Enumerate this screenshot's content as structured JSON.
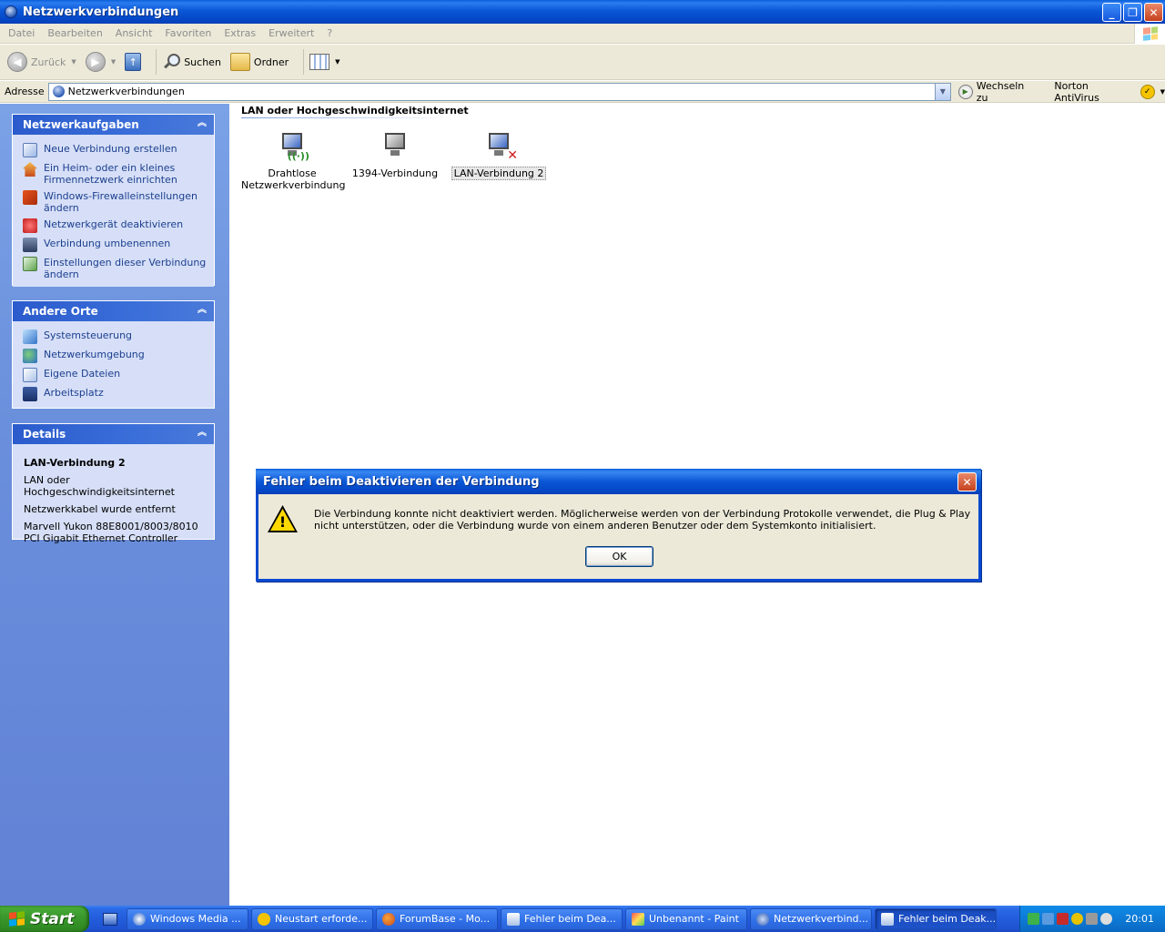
{
  "window": {
    "title": "Netzwerkverbindungen"
  },
  "menu": [
    "Datei",
    "Bearbeiten",
    "Ansicht",
    "Favoriten",
    "Extras",
    "Erweitert",
    "?"
  ],
  "toolbar": {
    "back": "Zurück",
    "search": "Suchen",
    "folders": "Ordner"
  },
  "address": {
    "label": "Adresse",
    "value": "Netzwerkverbindungen",
    "go": "Wechseln zu",
    "norton": "Norton AntiVirus"
  },
  "sidebar": {
    "tasks": {
      "title": "Netzwerkaufgaben",
      "items": [
        "Neue Verbindung erstellen",
        "Ein Heim- oder ein kleines Firmennetzwerk einrichten",
        "Windows-Firewalleinstellungen ändern",
        "Netzwerkgerät deaktivieren",
        "Verbindung umbenennen",
        "Einstellungen dieser Verbindung ändern"
      ]
    },
    "places": {
      "title": "Andere Orte",
      "items": [
        "Systemsteuerung",
        "Netzwerkumgebung",
        "Eigene Dateien",
        "Arbeitsplatz"
      ]
    },
    "details": {
      "title": "Details",
      "name": "LAN-Verbindung 2",
      "type": "LAN oder Hochgeschwindigkeitsinternet",
      "status": "Netzwerkkabel wurde entfernt",
      "device": "Marvell Yukon 88E8001/8003/8010 PCI Gigabit Ethernet Controller"
    }
  },
  "content": {
    "group": "LAN oder Hochgeschwindigkeitsinternet",
    "connections": [
      "Drahtlose Netzwerkverbindung",
      "1394-Verbindung",
      "LAN-Verbindung 2"
    ]
  },
  "dialog": {
    "title": "Fehler beim Deaktivieren der Verbindung",
    "message": "Die Verbindung konnte nicht deaktiviert werden. Möglicherweise werden von der Verbindung Protokolle verwendet, die Plug & Play nicht unterstützen, oder die Verbindung wurde von einem anderen Benutzer oder dem Systemkonto initialisiert.",
    "ok": "OK"
  },
  "taskbar": {
    "start": "Start",
    "items": [
      "Windows Media ...",
      "Neustart erforde...",
      "ForumBase - Mo...",
      "Fehler beim Dea...",
      "Unbenannt - Paint",
      "Netzwerkverbind...",
      "Fehler beim Deak..."
    ],
    "clock": "20:01"
  }
}
